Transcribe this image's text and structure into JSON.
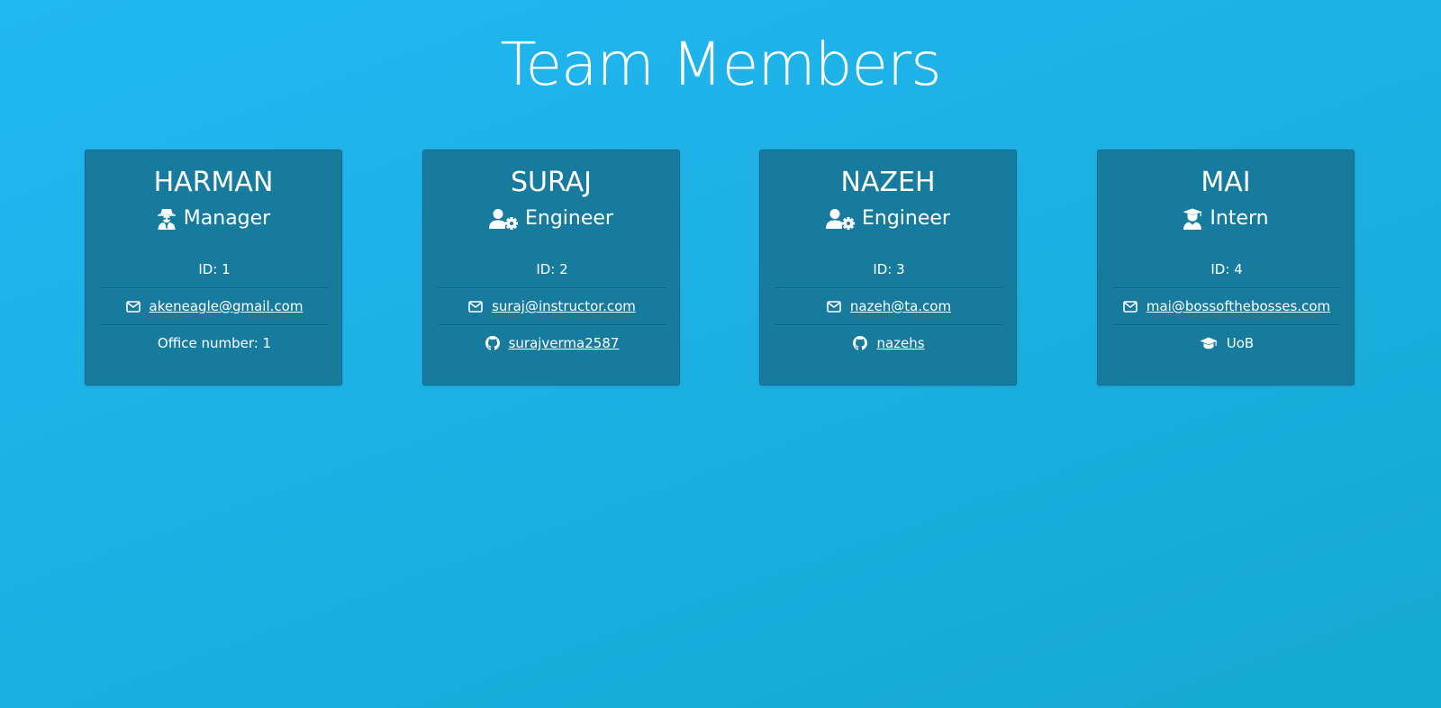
{
  "page": {
    "title": "Team Members"
  },
  "colors": {
    "background_start": "#21b7f3",
    "background_end": "#14a9d0",
    "card": "#177b9d",
    "text": "#ffffff"
  },
  "members": [
    {
      "name": "HARMAN",
      "role": "Manager",
      "role_icon": "user-secret-icon",
      "id_text": "ID: 1",
      "email": "akeneagle@gmail.com",
      "extra_icon": null,
      "extra_text": "Office number: 1"
    },
    {
      "name": "SURAJ",
      "role": "Engineer",
      "role_icon": "user-cog-icon",
      "id_text": "ID: 2",
      "email": "suraj@instructor.com",
      "extra_icon": "github-icon",
      "extra_text": "surajverma2587"
    },
    {
      "name": "NAZEH",
      "role": "Engineer",
      "role_icon": "user-cog-icon",
      "id_text": "ID: 3",
      "email": "nazeh@ta.com",
      "extra_icon": "github-icon",
      "extra_text": "nazehs"
    },
    {
      "name": "MAI",
      "role": "Intern",
      "role_icon": "user-graduate-icon",
      "id_text": "ID: 4",
      "email": "mai@bossofthebosses.com",
      "extra_icon": "graduation-cap-icon",
      "extra_text": "UoB"
    }
  ]
}
